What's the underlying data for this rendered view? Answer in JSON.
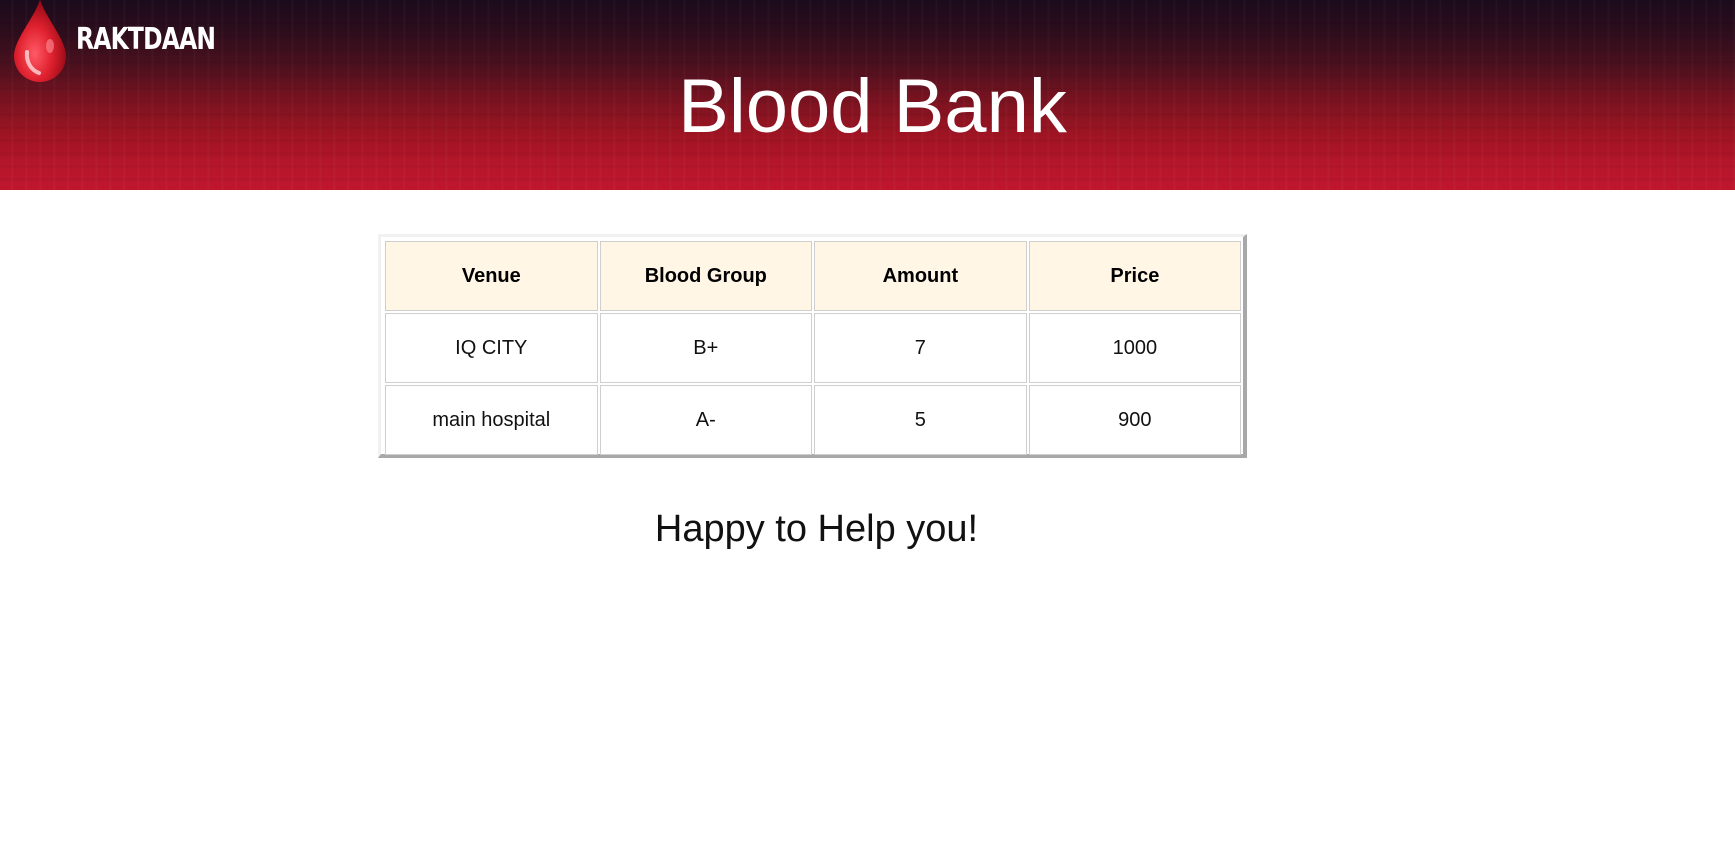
{
  "brand": {
    "logo_text": "RAKTDAAN",
    "icon": "blood-drop-icon",
    "accent": "#c0162d"
  },
  "header": {
    "title": "Blood Bank"
  },
  "table": {
    "headers": [
      "Venue",
      "Blood Group",
      "Amount",
      "Price"
    ],
    "rows": [
      [
        "IQ CITY",
        "B+",
        "7",
        "1000"
      ],
      [
        "main hospital",
        "A-",
        "5",
        "900"
      ]
    ]
  },
  "footer_message": "Happy to Help you!"
}
